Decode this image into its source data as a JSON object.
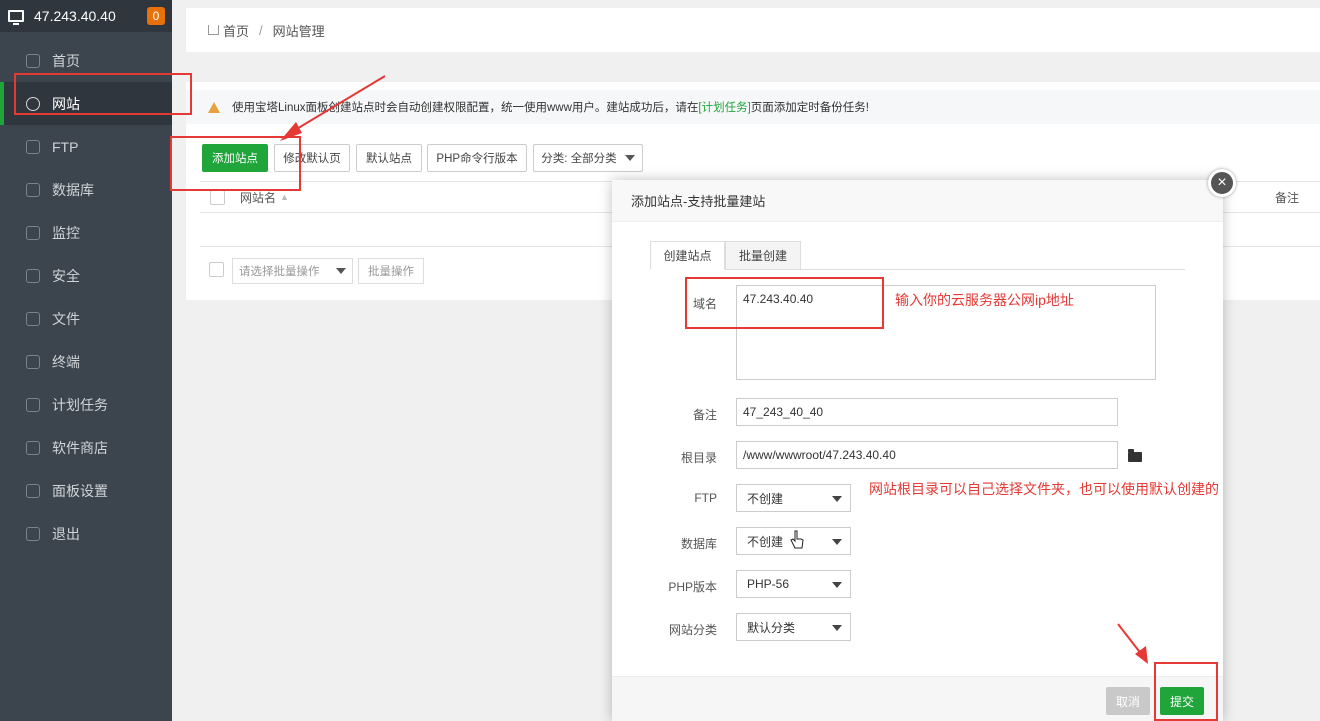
{
  "sidebar": {
    "server_ip": "47.243.40.40",
    "badge": "0",
    "items": [
      {
        "label": "首页",
        "icon": "home-icon"
      },
      {
        "label": "网站",
        "icon": "globe-icon"
      },
      {
        "label": "FTP",
        "icon": "ftp-icon"
      },
      {
        "label": "数据库",
        "icon": "database-icon"
      },
      {
        "label": "监控",
        "icon": "monitor-icon"
      },
      {
        "label": "安全",
        "icon": "shield-icon"
      },
      {
        "label": "文件",
        "icon": "folder-icon"
      },
      {
        "label": "终端",
        "icon": "terminal-icon"
      },
      {
        "label": "计划任务",
        "icon": "calendar-icon"
      },
      {
        "label": "软件商店",
        "icon": "grid-icon"
      },
      {
        "label": "面板设置",
        "icon": "gear-icon"
      },
      {
        "label": "退出",
        "icon": "logout-icon"
      }
    ]
  },
  "breadcrumb": {
    "home": "首页",
    "current": "网站管理"
  },
  "notice": {
    "prefix": "使用宝塔Linux面板创建站点时会自动创建权限配置，统一使用www用户。建站成功后，请在",
    "link": "[计划任务]",
    "suffix": "页面添加定时备份任务!"
  },
  "toolbar": {
    "add_site": "添加站点",
    "edit_default_page": "修改默认页",
    "default_site": "默认站点",
    "php_cli": "PHP命令行版本",
    "category": "分类: 全部分类"
  },
  "table": {
    "col_name": "网站名",
    "col_sort": "▲",
    "col_note": "备注"
  },
  "batch": {
    "select_placeholder": "请选择批量操作",
    "batch_button": "批量操作"
  },
  "modal": {
    "title": "添加站点-支持批量建站",
    "tabs": [
      "创建站点",
      "批量创建"
    ],
    "domain_label": "域名",
    "domain_value": "47.243.40.40",
    "note_label": "备注",
    "note_value": "47_243_40_40",
    "root_label": "根目录",
    "root_value": "/www/wwwroot/47.243.40.40",
    "ftp_label": "FTP",
    "ftp_value": "不创建",
    "db_label": "数据库",
    "db_value": "不创建",
    "php_label": "PHP版本",
    "php_value": "PHP-56",
    "cat_label": "网站分类",
    "cat_value": "默认分类",
    "cancel": "取消",
    "submit": "提交",
    "close": "×"
  },
  "annotations": {
    "domain_hint": "输入你的云服务器公网ip地址",
    "root_hint": "网站根目录可以自己选择文件夹，也可以使用默认创建的"
  },
  "colors": {
    "accent_green": "#20a53a",
    "annotation_red": "#e53935",
    "sidebar_bg": "#3c444d"
  }
}
